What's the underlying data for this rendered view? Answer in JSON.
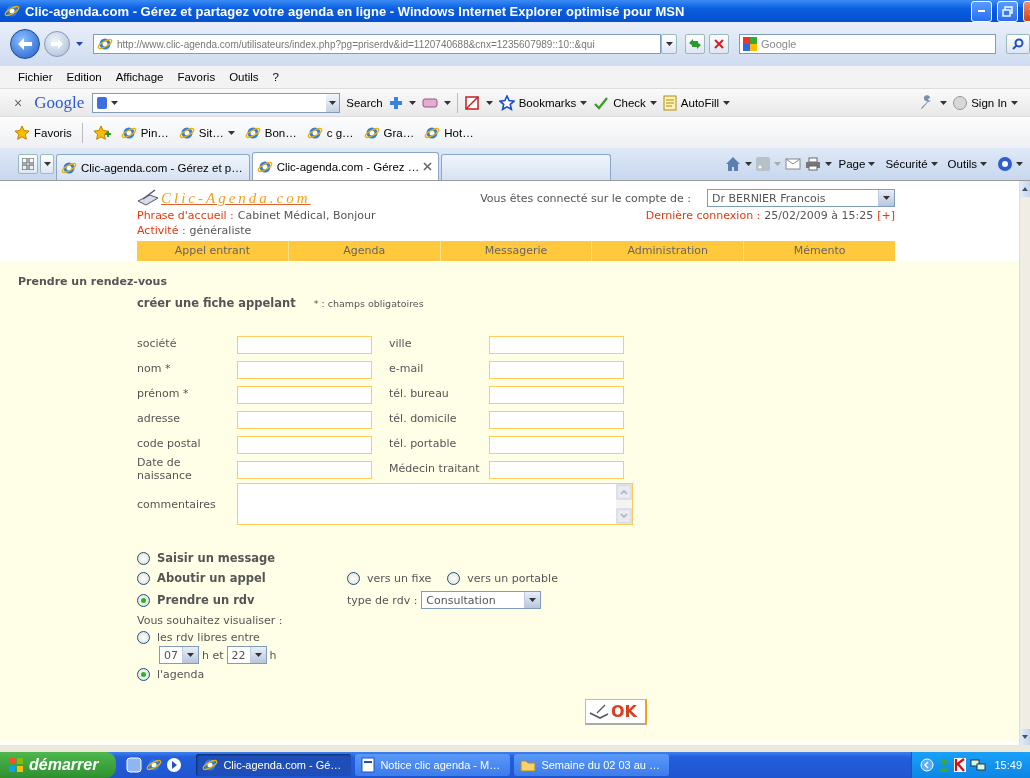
{
  "window": {
    "title": "Clic-agenda.com - Gérez et partagez votre agenda en ligne - Windows Internet Explorer optimisé pour MSN"
  },
  "browser": {
    "address": "http://www.clic-agenda.com/utilisateurs/index.php?pg=priserdv&id=1120740688&cnx=1235607989::10::&qui",
    "search_placeholder": "Google",
    "menu": [
      "Fichier",
      "Edition",
      "Affichage",
      "Favoris",
      "Outils",
      "?"
    ],
    "google_toolbar": {
      "close": "×",
      "logo": "Google",
      "search": "Search",
      "buttons": [
        "Bookmarks",
        "Check",
        "AutoFill"
      ],
      "sign_in": "Sign In"
    },
    "favorites": {
      "label": "Favoris",
      "items": [
        "Pin…",
        "Sit…",
        "Bon…",
        "c g…",
        "Gra…",
        "Hot…"
      ]
    },
    "tabs": [
      {
        "label": "Clic-agenda.com - Gérez et p…",
        "selected": false
      },
      {
        "label": "Clic-agenda.com - Gérez …",
        "selected": true
      }
    ],
    "commands": [
      "Page",
      "Sécurité",
      "Outils"
    ]
  },
  "page": {
    "logo": "Clic-Agenda.com",
    "account_label": "Vous êtes connecté sur le compte de :",
    "account": "Dr BERNIER Francois",
    "greeting_label": "Phrase d'accueil :",
    "greeting": "Cabinet Médical, Bonjour",
    "last_login_label": "Dernière connexion :",
    "last_login": "25/02/2009 à 15:25",
    "more_link": "[+]",
    "activity_label": "Activité :",
    "activity": "généraliste",
    "nav": [
      "Appel entrant",
      "Agenda",
      "Messagerie",
      "Administration",
      "Mémento"
    ],
    "heading": "Prendre un rendez-vous",
    "form": {
      "title": "créer une fiche appelant",
      "note": "* : champs obligatoires",
      "fields": [
        {
          "label": "société"
        },
        {
          "label": "ville"
        },
        {
          "label": "nom *"
        },
        {
          "label": "e-mail"
        },
        {
          "label": "prénom *"
        },
        {
          "label": "tél. bureau"
        },
        {
          "label": "adresse"
        },
        {
          "label": "tél. domicile"
        },
        {
          "label": "code postal"
        },
        {
          "label": "tél. portable"
        },
        {
          "label": "Date de naissance"
        },
        {
          "label": "Médecin traitant"
        }
      ],
      "comments": "commentaires"
    },
    "options": [
      {
        "kind": "plain",
        "label": "Saisir un message",
        "selected": false
      },
      {
        "kind": "call",
        "label": "Aboutir un appel",
        "selected": false,
        "targets": [
          {
            "label": "vers un fixe",
            "selected": false
          },
          {
            "label": "vers un portable",
            "selected": false
          }
        ]
      },
      {
        "kind": "appointment",
        "label": "Prendre un rdv",
        "selected": true,
        "type_label": "type de rdv :",
        "type": "Consultation"
      }
    ],
    "view_label": "Vous souhaitez visualiser :",
    "view_options": [
      {
        "kind": "range",
        "label": "les rdv libres entre",
        "selected": false,
        "from": "07",
        "between": "h et",
        "to": "22",
        "unit": "h"
      },
      {
        "kind": "plain",
        "label": "l'agenda",
        "selected": true
      }
    ],
    "submit": "OK"
  },
  "taskbar": {
    "start": "démarrer",
    "tasks": [
      {
        "label": "Clic-agenda.com - Gé…",
        "selected": true
      },
      {
        "label": "Notice clic agenda - M…",
        "selected": false
      },
      {
        "label": "Semaine du 02 03 au …",
        "selected": false
      }
    ],
    "clock": "15:49"
  }
}
